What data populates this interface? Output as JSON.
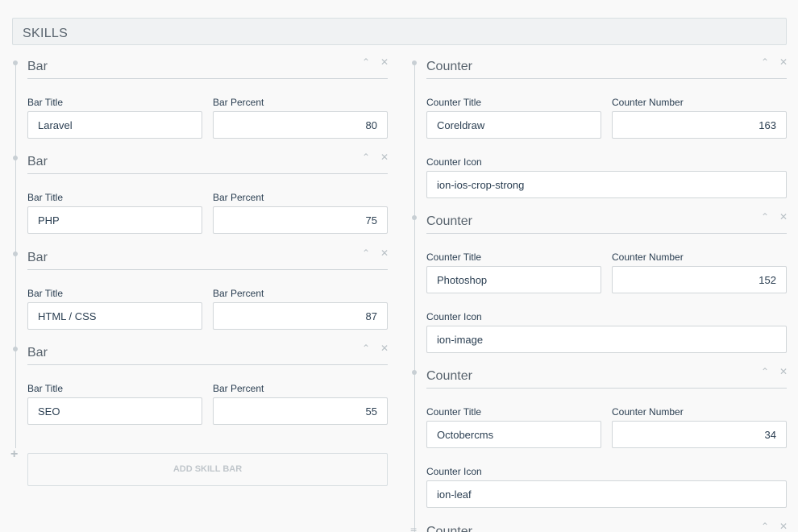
{
  "section": {
    "title": "SKILLS"
  },
  "bars": [
    {
      "heading": "Bar",
      "title_label": "Bar Title",
      "title_value": "Laravel",
      "percent_label": "Bar Percent",
      "percent_value": "80"
    },
    {
      "heading": "Bar",
      "title_label": "Bar Title",
      "title_value": "PHP",
      "percent_label": "Bar Percent",
      "percent_value": "75"
    },
    {
      "heading": "Bar",
      "title_label": "Bar Title",
      "title_value": "HTML / CSS",
      "percent_label": "Bar Percent",
      "percent_value": "87"
    },
    {
      "heading": "Bar",
      "title_label": "Bar Title",
      "title_value": "SEO",
      "percent_label": "Bar Percent",
      "percent_value": "55"
    }
  ],
  "add_bar_label": "ADD SKILL BAR",
  "counters": [
    {
      "heading": "Counter",
      "title_label": "Counter Title",
      "title_value": "Coreldraw",
      "number_label": "Counter Number",
      "number_value": "163",
      "icon_label": "Counter Icon",
      "icon_value": "ion-ios-crop-strong"
    },
    {
      "heading": "Counter",
      "title_label": "Counter Title",
      "title_value": "Photoshop",
      "number_label": "Counter Number",
      "number_value": "152",
      "icon_label": "Counter Icon",
      "icon_value": "ion-image"
    },
    {
      "heading": "Counter",
      "title_label": "Counter Title",
      "title_value": "Octobercms",
      "number_label": "Counter Number",
      "number_value": "34",
      "icon_label": "Counter Icon",
      "icon_value": "ion-leaf"
    },
    {
      "heading": "Counter"
    }
  ],
  "icons": {
    "move_up": "chevron-up-icon",
    "remove": "close-icon",
    "add": "plus-icon",
    "drag": "drag-handle-icon"
  }
}
